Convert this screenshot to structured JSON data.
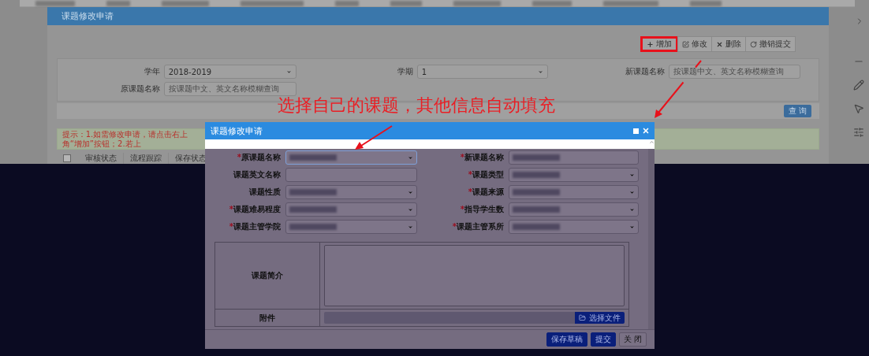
{
  "outer_dialog": {
    "title": "课题修改申请",
    "toolbar": [
      {
        "kind": "add",
        "label": "增加",
        "highlighted": true
      },
      {
        "kind": "edit",
        "label": "修改",
        "highlighted": false
      },
      {
        "kind": "delete",
        "label": "删除",
        "highlighted": false
      },
      {
        "kind": "revoke",
        "label": "撤销提交",
        "highlighted": false
      }
    ],
    "filters": [
      {
        "label": "学年",
        "kind": "select",
        "value": "2018-2019"
      },
      {
        "label": "学期",
        "kind": "select",
        "value": "1"
      },
      {
        "label": "新课题名称",
        "kind": "input",
        "placeholder": "按课题中文、英文名称模糊查询"
      },
      {
        "label": "原课题名称",
        "kind": "input",
        "placeholder": "按课题中文、英文名称模糊查询"
      }
    ],
    "search_button": "查 询",
    "hint": "提示：1.如需修改申请，请点击右上角“增加”按钮；2.若上",
    "table": {
      "select_all_checked": false,
      "columns": [
        "审核状态",
        "流程跟踪",
        "保存状态"
      ]
    }
  },
  "annotation": "选择自己的课题，其他信息自动填充",
  "modal": {
    "title": "课题修改申请",
    "fields": [
      {
        "label": "原课题名称",
        "required_mark": "*",
        "kind": "select",
        "focused": true,
        "value_hidden": true
      },
      {
        "label": "新课题名称",
        "required_mark": "*",
        "kind": "input",
        "focused": false,
        "value_hidden": true
      },
      {
        "label": "课题英文名称",
        "kind": "input",
        "focused": false,
        "value_hidden": false
      },
      {
        "label": "课题类型",
        "required_mark": "*",
        "kind": "select",
        "focused": false,
        "value_hidden": true
      },
      {
        "label": "课题性质",
        "kind": "select",
        "focused": false,
        "value_hidden": true
      },
      {
        "label": "课题来源",
        "required_mark": "*",
        "kind": "select",
        "focused": false,
        "value_hidden": true
      },
      {
        "label": "课题难易程度",
        "required_mark": "*",
        "kind": "select",
        "focused": false,
        "value_hidden": true
      },
      {
        "label": "指导学生数",
        "required_mark": "*",
        "kind": "select",
        "focused": false,
        "value_hidden": true
      },
      {
        "label": "课题主管学院",
        "required_mark": "*",
        "kind": "select",
        "focused": false,
        "value_hidden": true
      },
      {
        "label": "课题主管系所",
        "required_mark": "*",
        "kind": "select",
        "focused": false,
        "value_hidden": true
      }
    ],
    "intro_label": "课题简介",
    "attachment_label": "附件",
    "file_button": "选择文件",
    "buttons": [
      {
        "label": "保存草稿",
        "kind": "primary"
      },
      {
        "label": "提交",
        "kind": "primary"
      },
      {
        "label": "关 闭",
        "kind": "default"
      }
    ]
  }
}
